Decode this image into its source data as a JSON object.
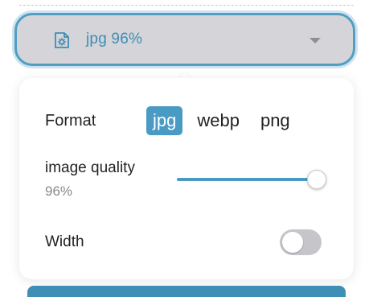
{
  "dropdown": {
    "label": "jpg 96%",
    "icon": "file-settings-icon"
  },
  "panel": {
    "format": {
      "label": "Format",
      "options": [
        "jpg",
        "webp",
        "png"
      ],
      "selected": "jpg"
    },
    "quality": {
      "label": "image quality",
      "value_text": "96%",
      "value": 0.96
    },
    "width": {
      "label": "Width",
      "enabled": false
    }
  },
  "colors": {
    "accent": "#4a9bc4",
    "dropdown_bg": "#d4d4d9",
    "toggle_off": "#c5c5ca"
  }
}
